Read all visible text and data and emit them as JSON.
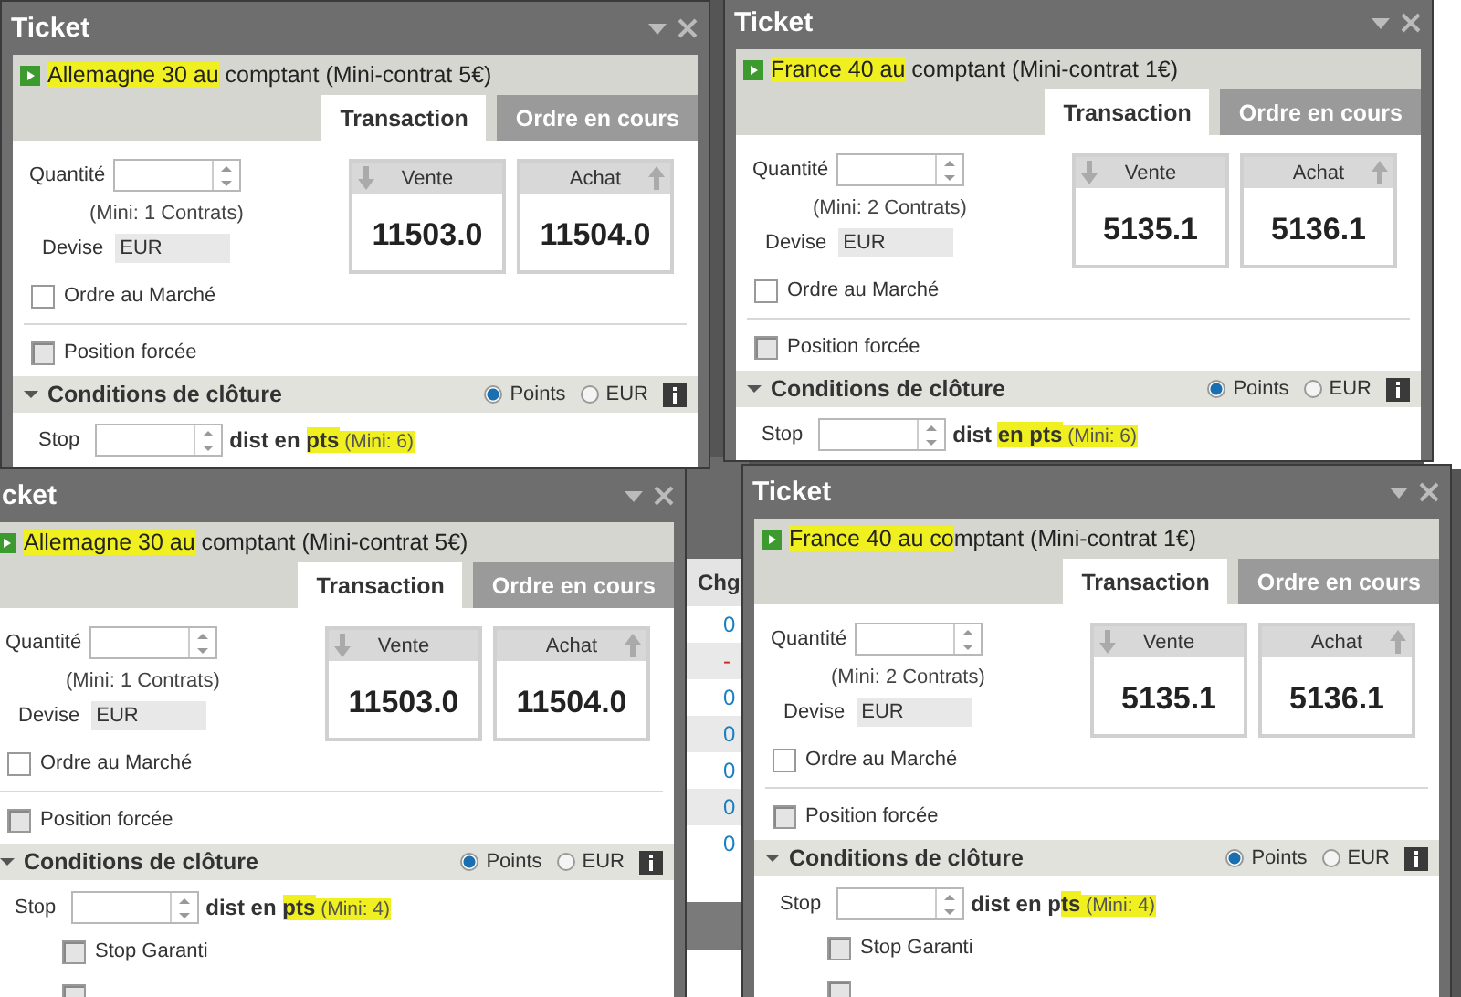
{
  "background_grid": {
    "columns": [
      "Chg"
    ],
    "cells": [
      {
        "text": "0",
        "color": "#1a7fc0"
      },
      {
        "text": "-",
        "color": "#d02020"
      },
      {
        "text": "0",
        "color": "#1a7fc0"
      },
      {
        "text": "0",
        "color": "#1a7fc0"
      },
      {
        "text": "0",
        "color": "#1a7fc0"
      },
      {
        "text": "0",
        "color": "#1a7fc0"
      },
      {
        "text": "0",
        "color": "#1a7fc0"
      }
    ]
  },
  "windows": [
    {
      "title": "Ticket",
      "instrument": [
        {
          "text": "Allemagne 30 au",
          "highlighted": true
        },
        {
          "text": " comptant (Mini-contrat 5€)",
          "highlighted": false
        }
      ],
      "tabs": [
        {
          "label": "Transaction",
          "selected": true
        },
        {
          "label": "Ordre en cours",
          "selected": false
        }
      ],
      "quantity_label": "Quantité",
      "quantity_min": "(Mini: 1 Contrats)",
      "currency_label": "Devise",
      "currency": "EUR",
      "prices": [
        {
          "kind": "sell",
          "label": "Vente",
          "value": "11503.0"
        },
        {
          "kind": "buy",
          "label": "Achat",
          "value": "11504.0"
        }
      ],
      "market_order": {
        "label": "Ordre au Marché",
        "checked": false
      },
      "forced_position": {
        "label": "Position forcée",
        "checked": false
      },
      "closing": {
        "title": "Conditions de clôture",
        "expanded": true,
        "options": [
          {
            "label": "Points",
            "selected": true
          },
          {
            "label": "EUR",
            "selected": false
          }
        ]
      },
      "stop": {
        "label": "Stop",
        "text": [
          {
            "text": "dist en ",
            "kind": "bold",
            "highlighted": false
          },
          {
            "text": "pts",
            "kind": "bold",
            "highlighted": true
          },
          {
            "text": " (Mini: 6)",
            "kind": "note",
            "highlighted": true
          }
        ]
      }
    },
    {
      "title": "Ticket",
      "instrument": [
        {
          "text": "France 40 au",
          "highlighted": true
        },
        {
          "text": " comptant (Mini-contrat 1€)",
          "highlighted": false
        }
      ],
      "tabs": [
        {
          "label": "Transaction",
          "selected": true
        },
        {
          "label": "Ordre en cours",
          "selected": false
        }
      ],
      "quantity_label": "Quantité",
      "quantity_min": "(Mini: 2 Contrats)",
      "currency_label": "Devise",
      "currency": "EUR",
      "prices": [
        {
          "kind": "sell",
          "label": "Vente",
          "value": "5135.1"
        },
        {
          "kind": "buy",
          "label": "Achat",
          "value": "5136.1"
        }
      ],
      "market_order": {
        "label": "Ordre au Marché",
        "checked": false
      },
      "forced_position": {
        "label": "Position forcée",
        "checked": false
      },
      "closing": {
        "title": "Conditions de clôture",
        "expanded": true,
        "options": [
          {
            "label": "Points",
            "selected": true
          },
          {
            "label": "EUR",
            "selected": false
          }
        ]
      },
      "stop": {
        "label": "Stop",
        "text": [
          {
            "text": "dist ",
            "kind": "bold",
            "highlighted": false
          },
          {
            "text": "en pts",
            "kind": "bold",
            "highlighted": true
          },
          {
            "text": " (Mini: 6)",
            "kind": "note",
            "highlighted": true
          }
        ]
      }
    },
    {
      "title": "cket",
      "instrument": [
        {
          "text": "Allemagne 30 au",
          "highlighted": true
        },
        {
          "text": " comptant (Mini-contrat 5€)",
          "highlighted": false
        }
      ],
      "tabs": [
        {
          "label": "Transaction",
          "selected": true
        },
        {
          "label": "Ordre en cours",
          "selected": false
        }
      ],
      "quantity_label": "Quantité",
      "quantity_min": "(Mini: 1 Contrats)",
      "currency_label": "Devise",
      "currency": "EUR",
      "prices": [
        {
          "kind": "sell",
          "label": "Vente",
          "value": "11503.0"
        },
        {
          "kind": "buy",
          "label": "Achat",
          "value": "11504.0"
        }
      ],
      "market_order": {
        "label": "Ordre au Marché",
        "checked": false
      },
      "forced_position": {
        "label": "Position forcée",
        "checked": false
      },
      "closing": {
        "title": "Conditions de clôture",
        "expanded": true,
        "options": [
          {
            "label": "Points",
            "selected": true
          },
          {
            "label": "EUR",
            "selected": false
          }
        ]
      },
      "stop": {
        "label": "Stop",
        "text": [
          {
            "text": "dist en ",
            "kind": "bold",
            "highlighted": false
          },
          {
            "text": "pts",
            "kind": "bold",
            "highlighted": true
          },
          {
            "text": " (Mini: 4)",
            "kind": "note",
            "highlighted": true
          }
        ]
      },
      "stop_options": [
        {
          "label": "Stop Garanti",
          "checked": false
        },
        {
          "checked": false
        }
      ]
    },
    {
      "title": "Ticket",
      "instrument": [
        {
          "text": "France 40 au co",
          "highlighted": true
        },
        {
          "text": "mptant (Mini-contrat 1€)",
          "highlighted": false
        }
      ],
      "tabs": [
        {
          "label": "Transaction",
          "selected": true
        },
        {
          "label": "Ordre en cours",
          "selected": false
        }
      ],
      "quantity_label": "Quantité",
      "quantity_min": "(Mini: 2 Contrats)",
      "currency_label": "Devise",
      "currency": "EUR",
      "prices": [
        {
          "kind": "sell",
          "label": "Vente",
          "value": "5135.1"
        },
        {
          "kind": "buy",
          "label": "Achat",
          "value": "5136.1"
        }
      ],
      "market_order": {
        "label": "Ordre au Marché",
        "checked": false
      },
      "forced_position": {
        "label": "Position forcée",
        "checked": false
      },
      "closing": {
        "title": "Conditions de clôture",
        "expanded": true,
        "options": [
          {
            "label": "Points",
            "selected": true
          },
          {
            "label": "EUR",
            "selected": false
          }
        ]
      },
      "stop": {
        "label": "Stop",
        "text": [
          {
            "text": "dist en p",
            "kind": "bold",
            "highlighted": false
          },
          {
            "text": "ts",
            "kind": "bold",
            "highlighted": true
          },
          {
            "text": " (Mini: 4)",
            "kind": "note",
            "highlighted": true
          }
        ]
      },
      "stop_options": [
        {
          "label": "Stop Garanti",
          "checked": false
        },
        {
          "checked": false
        }
      ]
    }
  ]
}
